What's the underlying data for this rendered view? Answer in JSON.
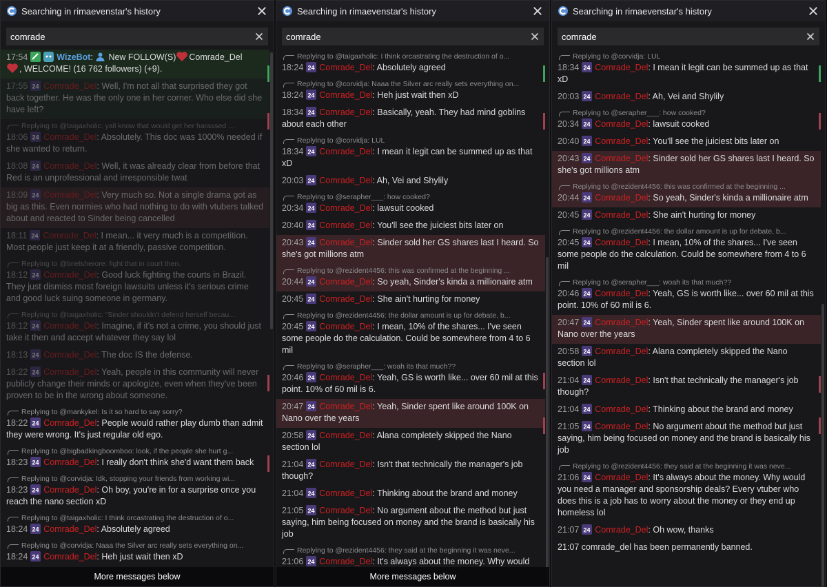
{
  "title": "Searching in rimaevenstar's history",
  "search_value": "comrade",
  "more_label": "More messages below",
  "badge_text": "24",
  "pane1": [
    {
      "t": "17:54",
      "user": "WizeBot",
      "wize": true,
      "text": "New FOLLOW(S)",
      "extra": "Comrade_Del",
      "extra2": ", WELCOME! (16 762 followers) (+9).",
      "hl": "hl2"
    },
    {
      "t": "17:55",
      "user": "Comrade_Del",
      "text": "Well, I'm not all that surprised they got back together. He was the only one in her corner. Who else did she have left?",
      "dim": true,
      "hl": "hl2"
    },
    {
      "reply": "@taigaxholic: yall know that would get her harassed ...",
      "t": "18:06",
      "user": "Comrade_Del",
      "text": "Absolutely. This doc was 1000% needed if she wanted to return.",
      "dim": true
    },
    {
      "t": "18:08",
      "user": "Comrade_Del",
      "text": "Well, it was already clear from before that Red is an unprofessional and irresponsible twat",
      "dim": true
    },
    {
      "t": "18:09",
      "user": "Comrade_Del",
      "text": "Very much so. Not a single drama got as big as this. Even normies who had nothing to do with vtubers talked about and reacted to Sinder being cancelled",
      "dim": true,
      "hl": "hl"
    },
    {
      "t": "18:11",
      "user": "Comrade_Del",
      "text": "I mean... it very much is a competition. Most people just keep it at a friendly, passive competition.",
      "dim": true
    },
    {
      "reply": "@brielsherore: fight that in court then.",
      "t": "18:12",
      "user": "Comrade_Del",
      "text": "Good luck fighting the courts in Brazil. They just dismiss most foreign lawsuits unless it's serious crime and good luck suing someone in germany.",
      "dim": true
    },
    {
      "reply": "@taigaxholic: \"Sinder shouldn't defend herself becau...",
      "t": "18:12",
      "user": "Comrade_Del",
      "text": "Imagine, if it's not a crime, you should just take it then and accept whatever they say lol",
      "dim": true
    },
    {
      "t": "18:13",
      "user": "Comrade_Del",
      "text": "The doc IS the defense.",
      "dim": true
    },
    {
      "t": "18:22",
      "user": "Comrade_Del",
      "text": "Yeah, people in this community will never publicly change their minds or apologize, even when they've been proven to be in the wrong about someone.",
      "dim": true
    },
    {
      "reply": "@mankykel: Is it so hard to say sorry?",
      "t": "18:22",
      "user": "Comrade_Del",
      "text": "People would rather play dumb than admit they were wrong. It's just regular old ego."
    },
    {
      "reply": "@bigbadkingboomboo: look, if the people she hurt g...",
      "t": "18:23",
      "user": "Comrade_Del",
      "text": "I really don't think she'd want them back"
    },
    {
      "reply": "@corvidja: Idk, stopping your friends from working wi...",
      "t": "18:23",
      "user": "Comrade_Del",
      "text": "Oh boy, you're in for a surprise once you reach the nano section xD"
    },
    {
      "reply": "@taigaxholic: I think orcastrating the destruction of o...",
      "t": "18:24",
      "user": "Comrade_Del",
      "text": "Absolutely agreed"
    },
    {
      "reply": "@corvidja: Naaa the Silver arc really sets everything on...",
      "t": "18:24",
      "user": "Comrade_Del",
      "text": "Heh just wait then xD"
    }
  ],
  "pane2": [
    {
      "reply": "@taigaxholic: I think orcastrating the destruction of o...",
      "t": "18:24",
      "user": "Comrade_Del",
      "text": "Absolutely agreed"
    },
    {
      "reply": "@corvidja: Naaa the Silver arc really sets everything on...",
      "t": "18:24",
      "user": "Comrade_Del",
      "text": "Heh just wait then xD"
    },
    {
      "t": "18:34",
      "user": "Comrade_Del",
      "text": "Basically, yeah. They had mind goblins about each other"
    },
    {
      "reply": "@corvidja: LUL",
      "t": "18:34",
      "user": "Comrade_Del",
      "text": "I mean it legit can be summed up as that xD"
    },
    {
      "t": "20:03",
      "user": "Comrade_Del",
      "text": "Ah, Vei and Shylily"
    },
    {
      "reply": "@serapher___: how cooked?",
      "t": "20:34",
      "user": "Comrade_Del",
      "text": "lawsuit cooked"
    },
    {
      "t": "20:40",
      "user": "Comrade_Del",
      "text": "You'll see the juiciest bits later on"
    },
    {
      "t": "20:43",
      "user": "Comrade_Del",
      "text": "Sinder sold her GS shares last I heard. So she's got millions atm",
      "hl": "hl"
    },
    {
      "reply": "@rezident4456: this was confirmed at the beginning ...",
      "t": "20:44",
      "user": "Comrade_Del",
      "text": "So yeah, Sinder's kinda a millionaire atm",
      "hl": "hl"
    },
    {
      "t": "20:45",
      "user": "Comrade_Del",
      "text": "She ain't hurting for money"
    },
    {
      "reply": "@rezident4456: the dollar amount is up for debate, b...",
      "t": "20:45",
      "user": "Comrade_Del",
      "text": "I mean, 10% of the shares... I've seen some people do the calculation. Could be somewhere from 4 to 6 mil"
    },
    {
      "reply": "@serapher___: woah its that much??",
      "t": "20:46",
      "user": "Comrade_Del",
      "text": "Yeah, GS is worth like... over 60 mil at this point. 10% of 60 mil is 6."
    },
    {
      "t": "20:47",
      "user": "Comrade_Del",
      "text": "Yeah, Sinder spent like around 100K on Nano over the years",
      "hl": "hl"
    },
    {
      "t": "20:58",
      "user": "Comrade_Del",
      "text": "Alana completely skipped the Nano section lol"
    },
    {
      "t": "21:04",
      "user": "Comrade_Del",
      "text": "Isn't that technically the manager's job though?"
    },
    {
      "t": "21:04",
      "user": "Comrade_Del",
      "text": "Thinking about the brand and money"
    },
    {
      "t": "21:05",
      "user": "Comrade_Del",
      "text": "No argument about the method but just saying, him being focused on money and the brand is basically his job"
    },
    {
      "reply": "@rezident4456: they said at the beginning it was neve...",
      "t": "21:06",
      "user": "Comrade_Del",
      "text": "It's always about the money. Why would"
    }
  ],
  "pane3": [
    {
      "reply": "@corvidja: LUL",
      "t": "18:34",
      "user": "Comrade_Del",
      "text": "I mean it legit can be summed up as that xD"
    },
    {
      "t": "20:03",
      "user": "Comrade_Del",
      "text": "Ah, Vei and Shylily"
    },
    {
      "reply": "@serapher___: how cooked?",
      "t": "20:34",
      "user": "Comrade_Del",
      "text": "lawsuit cooked"
    },
    {
      "t": "20:40",
      "user": "Comrade_Del",
      "text": "You'll see the juiciest bits later on"
    },
    {
      "t": "20:43",
      "user": "Comrade_Del",
      "text": "Sinder sold her GS shares last I heard. So she's got millions atm",
      "hl": "hl"
    },
    {
      "reply": "@rezident4456: this was confirmed at the beginning ...",
      "t": "20:44",
      "user": "Comrade_Del",
      "text": "So yeah, Sinder's kinda a millionaire atm",
      "hl": "hl"
    },
    {
      "t": "20:45",
      "user": "Comrade_Del",
      "text": "She ain't hurting for money"
    },
    {
      "reply": "@rezident4456: the dollar amount is up for debate, b...",
      "t": "20:45",
      "user": "Comrade_Del",
      "text": "I mean, 10% of the shares... I've seen some people do the calculation. Could be somewhere from 4 to 6 mil"
    },
    {
      "reply": "@serapher___: woah its that much??",
      "t": "20:46",
      "user": "Comrade_Del",
      "text": "Yeah, GS is worth like... over 60 mil at this point. 10% of 60 mil is 6."
    },
    {
      "t": "20:47",
      "user": "Comrade_Del",
      "text": "Yeah, Sinder spent like around 100K on Nano over the years",
      "hl": "hl"
    },
    {
      "t": "20:58",
      "user": "Comrade_Del",
      "text": "Alana completely skipped the Nano section lol"
    },
    {
      "t": "21:04",
      "user": "Comrade_Del",
      "text": "Isn't that technically the manager's job though?"
    },
    {
      "t": "21:04",
      "user": "Comrade_Del",
      "text": "Thinking about the brand and money"
    },
    {
      "t": "21:05",
      "user": "Comrade_Del",
      "text": "No argument about the method but just saying, him being focused on money and the brand is basically his job"
    },
    {
      "reply": "@rezident4456: they said at the beginning it was neve...",
      "t": "21:06",
      "user": "Comrade_Del",
      "text": "It's always about the money. Why would you need a manager and sponsorship deals? Every vtuber who does this is a job has to worry about the money or they end up homeless lol"
    },
    {
      "t": "21:07",
      "user": "Comrade_Del",
      "text": "Oh wow, thanks"
    },
    {
      "sys": "21:07 comrade_del has been permanently banned."
    }
  ],
  "reply_prefix": "Replying to "
}
